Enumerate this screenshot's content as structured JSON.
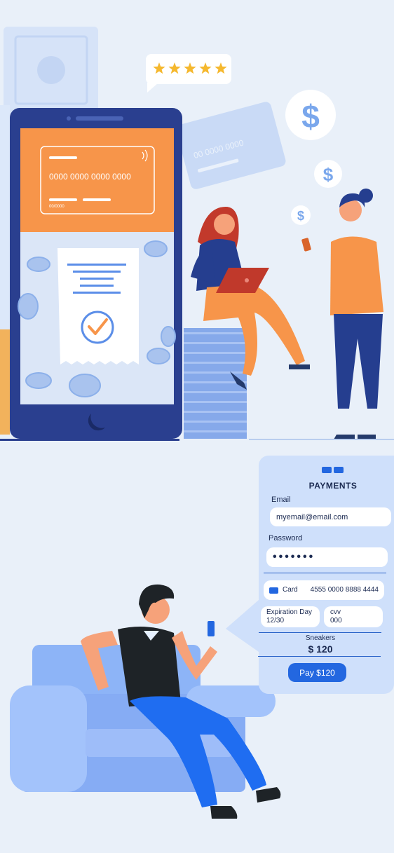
{
  "colors": {
    "background": "#e9f0f9",
    "phone_frame": "#2a3f8f",
    "accent_orange": "#f7954a",
    "accent_blue": "#2367e0",
    "panel": "#cfe0fb"
  },
  "rating": {
    "stars": 5,
    "star_icon": "star-icon"
  },
  "phone_card": {
    "number": "0000 0000 0000 0000",
    "expiry": "00/0000"
  },
  "back_card": {
    "number": "00 0000 0000"
  },
  "payment": {
    "header_icon": "cards-icon",
    "title": "PAYMENTS",
    "email_label": "Email",
    "email_value": "myemail@email.com",
    "password_label": "Password",
    "password_value": "•••••••",
    "card_label": "Card",
    "card_number": "4555 0000 8888 4444",
    "expiration_label": "Expiration Day",
    "expiration_value": "12/30",
    "cvv_label": "cvv",
    "cvv_value": "000",
    "product_name": "Sneakers",
    "product_price": "$ 120",
    "pay_button": "Pay $120"
  }
}
